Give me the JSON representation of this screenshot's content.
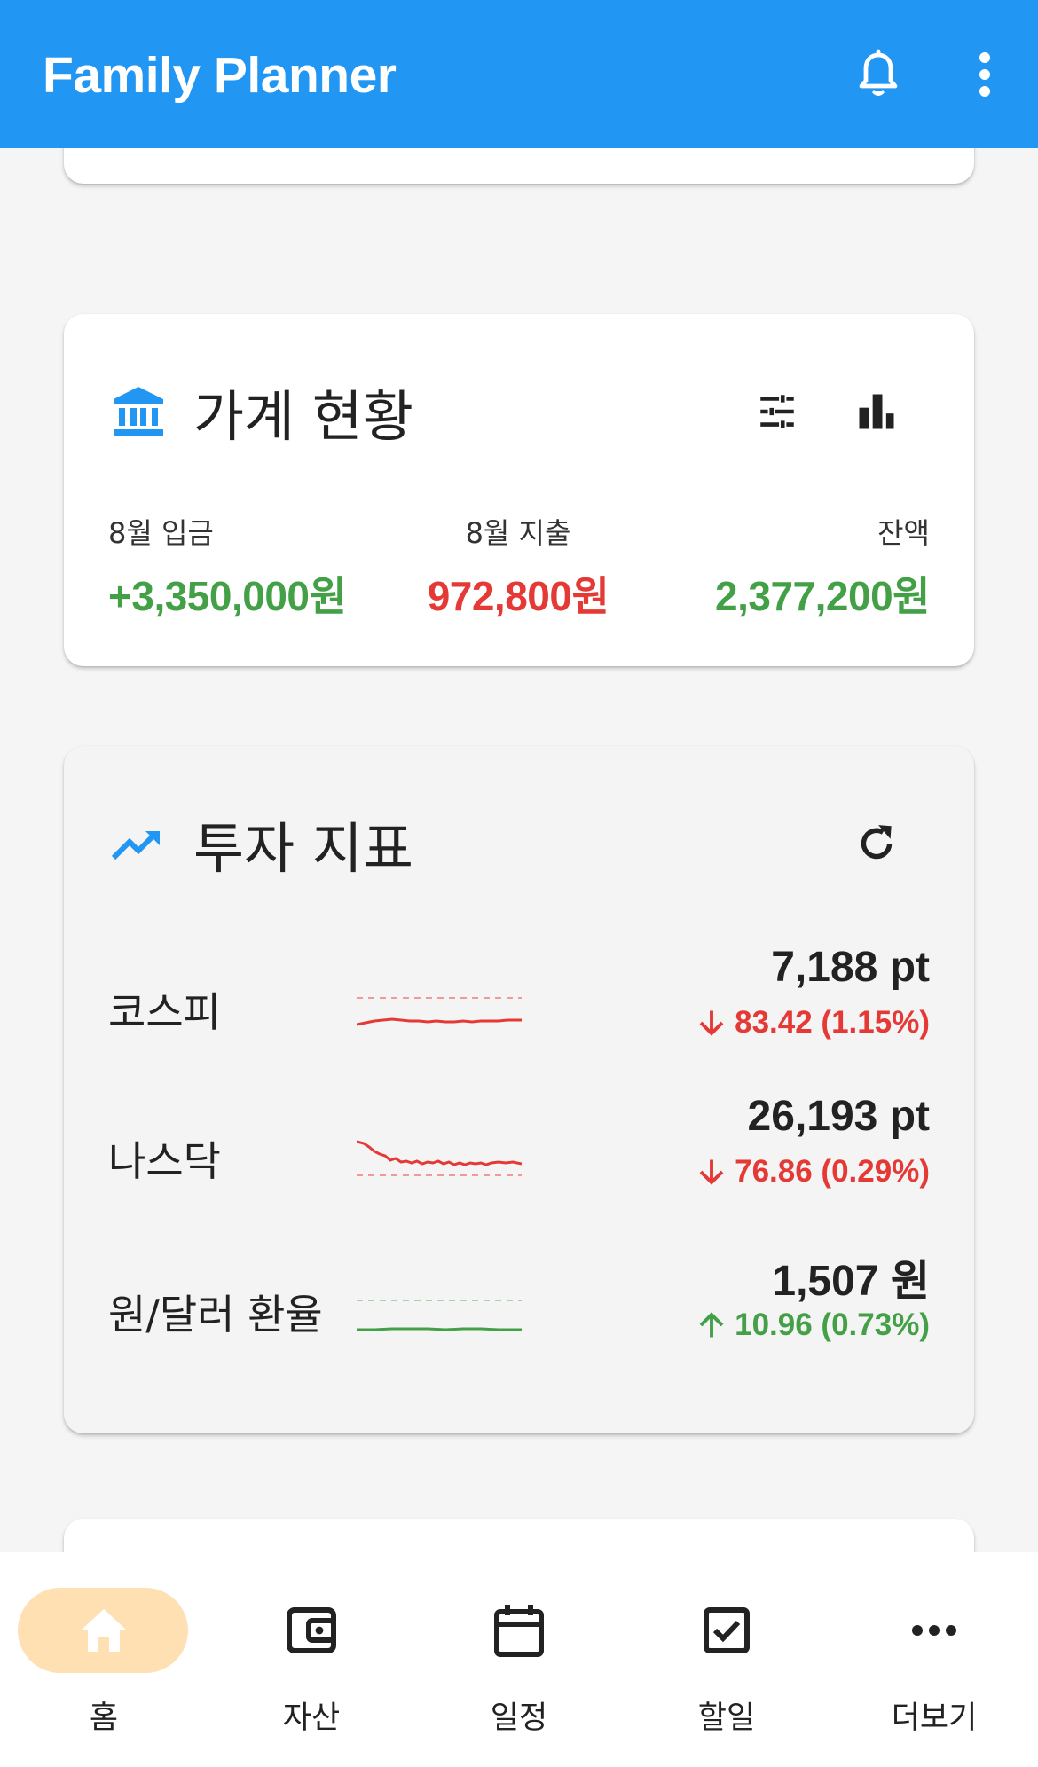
{
  "appbar": {
    "title": "Family Planner",
    "actions": [
      "bell-icon",
      "more-vert-icon"
    ]
  },
  "budget_card": {
    "title": "가계 현황",
    "icon": "bank-icon",
    "actions": [
      "tune-icon",
      "bar-chart-icon"
    ],
    "income_label": "8월 입금",
    "income_value": "+3,350,000원",
    "expense_label": "8월 지출",
    "expense_value": "972,800원",
    "balance_label": "잔액",
    "balance_value": "2,377,200원",
    "colors": {
      "positive": "#43a047",
      "negative": "#e53935"
    }
  },
  "invest_card": {
    "title": "투자 지표",
    "icon": "trending-up-icon",
    "refresh_icon": "refresh-icon",
    "rows": [
      {
        "name": "코스피",
        "price": "7,188 pt",
        "change": "83.42 (1.15%)",
        "direction": "down",
        "color": "#e53935"
      },
      {
        "name": "나스닥",
        "price": "26,193 pt",
        "change": "76.86 (0.29%)",
        "direction": "down",
        "color": "#e53935"
      },
      {
        "name": "원/달러 환율",
        "price": "1,507 원",
        "change": "10.96 (0.73%)",
        "direction": "up",
        "color": "#43a047"
      }
    ]
  },
  "bottom_nav": {
    "items": [
      {
        "label": "홈",
        "icon": "home-icon",
        "active": true
      },
      {
        "label": "자산",
        "icon": "wallet-icon",
        "active": false
      },
      {
        "label": "일정",
        "icon": "calendar-icon",
        "active": false
      },
      {
        "label": "할일",
        "icon": "checkbox-icon",
        "active": false
      },
      {
        "label": "더보기",
        "icon": "more-horiz-icon",
        "active": false
      }
    ]
  },
  "colors": {
    "appbar": "#2196f3",
    "accent": "#2196f3",
    "nav_active": "#ffe0b2"
  }
}
